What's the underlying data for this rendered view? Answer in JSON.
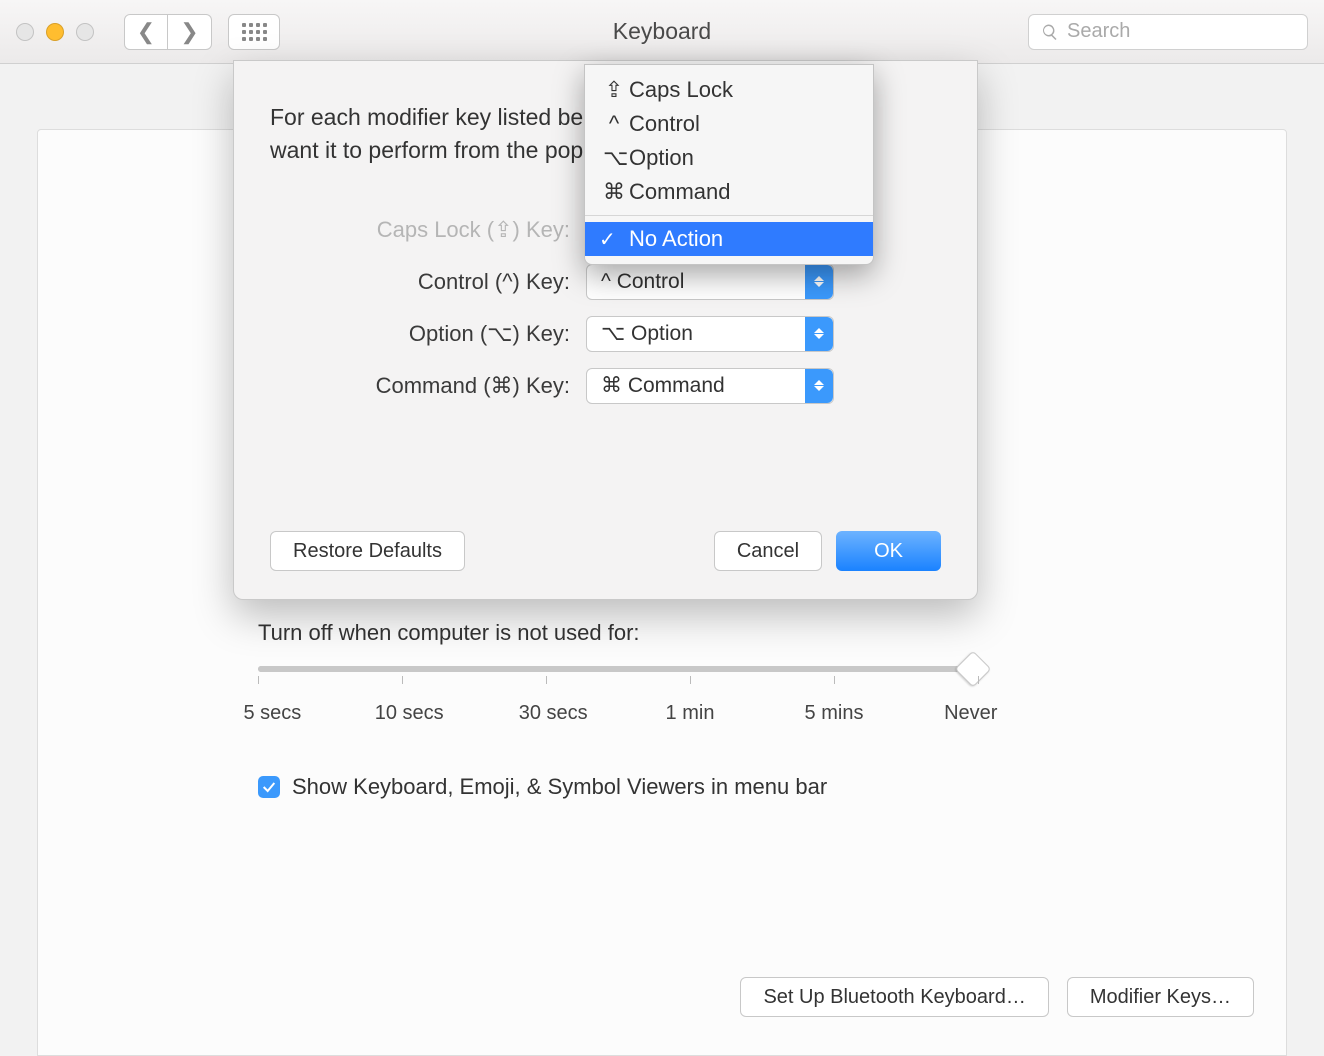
{
  "window": {
    "title": "Keyboard"
  },
  "toolbar": {
    "search_placeholder": "Search"
  },
  "sheet": {
    "instructions_l1": "For each modifier key listed below, choose the action you",
    "instructions_l2": "want it to perform from the pop-up menu.",
    "rows": {
      "capslock": {
        "label": "Caps Lock (⇪) Key:",
        "value": "No Action"
      },
      "control": {
        "label": "Control (^) Key:",
        "value": "^ Control"
      },
      "option": {
        "label": "Option (⌥) Key:",
        "value": "⌥ Option"
      },
      "command": {
        "label": "Command (⌘) Key:",
        "value": "⌘ Command"
      }
    },
    "restore": "Restore Defaults",
    "cancel": "Cancel",
    "ok": "OK"
  },
  "popup": {
    "items": [
      {
        "sym": "⇪",
        "label": "Caps Lock"
      },
      {
        "sym": "^",
        "label": "Control"
      },
      {
        "sym": "⌥",
        "label": "Option"
      },
      {
        "sym": "⌘",
        "label": "Command"
      }
    ],
    "selected": "No Action"
  },
  "pane": {
    "turnoff_label": "Turn off when computer is not used for:",
    "ticks": [
      "5 secs",
      "10 secs",
      "30 secs",
      "1 min",
      "5 mins",
      "Never"
    ],
    "checkbox_label": "Show Keyboard, Emoji, & Symbol Viewers in menu bar",
    "bt_button": "Set Up Bluetooth Keyboard…",
    "mod_button": "Modifier Keys…"
  }
}
